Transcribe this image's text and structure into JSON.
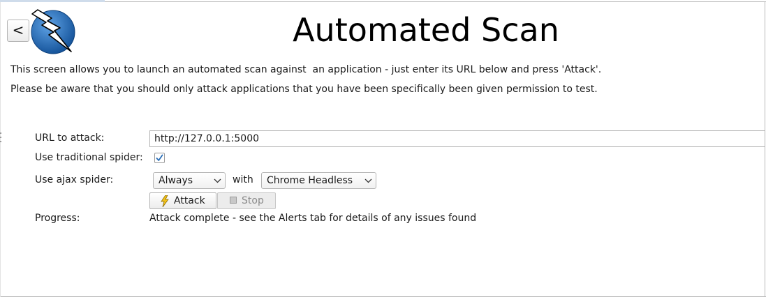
{
  "header": {
    "back_label": "<",
    "title": "Automated Scan"
  },
  "description": {
    "line1": "This screen allows you to launch an automated scan against  an application - just enter its URL below and press 'Attack'.",
    "line2": "Please be aware that you should only attack applications that you have been specifically been given permission to test."
  },
  "form": {
    "url_label": "URL to attack:",
    "url_value": "http://127.0.0.1:5000",
    "traditional_spider_label": "Use traditional spider:",
    "traditional_spider_checked": true,
    "ajax_spider_label": "Use ajax spider:",
    "ajax_spider_mode": "Always",
    "with_label": "with",
    "ajax_browser": "Chrome Headless",
    "attack_label": "Attack",
    "stop_label": "Stop",
    "progress_label": "Progress:",
    "progress_value": "Attack complete - see the Alerts tab for details of any issues found"
  },
  "colors": {
    "logo_blue": "#1e67b5",
    "checkbox_blue": "#2a6fb8",
    "bolt_yellow": "#f3c21a"
  },
  "icons": [
    "back-arrow",
    "zap-logo-icon",
    "checkmark-icon",
    "chevron-down-icon",
    "lightning-bolt-icon",
    "stop-square-icon"
  ]
}
